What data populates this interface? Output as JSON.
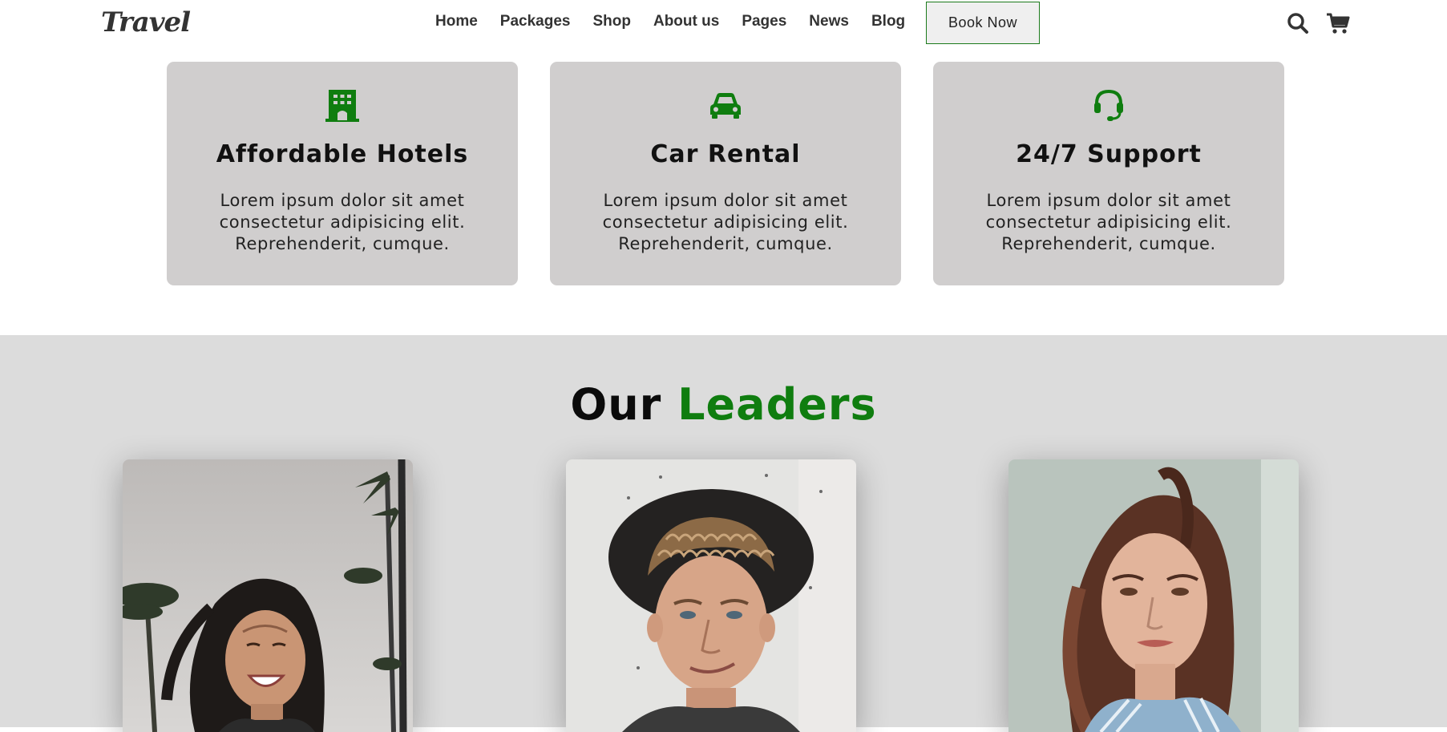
{
  "nav": {
    "logo": "Travel",
    "links": [
      "Home",
      "Packages",
      "Shop",
      "About us",
      "Pages",
      "News",
      "Blog"
    ],
    "book_label": "Book Now",
    "icons": [
      "search-icon",
      "cart-icon"
    ]
  },
  "features": [
    {
      "icon": "building-icon",
      "title": "Affordable Hotels",
      "text": "Lorem ipsum dolor sit amet consectetur adipisicing elit. Reprehenderit, cumque."
    },
    {
      "icon": "car-icon",
      "title": "Car Rental",
      "text": "Lorem ipsum dolor sit amet consectetur adipisicing elit. Reprehenderit, cumque."
    },
    {
      "icon": "headset-icon",
      "title": "24/7 Support",
      "text": "Lorem ipsum dolor sit amet consectetur adipisicing elit. Reprehenderit, cumque."
    }
  ],
  "leaders": {
    "title_part1": "Our",
    "title_part2": "Leaders",
    "photos": [
      "leader-photo-woman-smiling",
      "leader-photo-man-hat",
      "leader-photo-woman-ponytail"
    ]
  },
  "colors": {
    "accent": "#0f7d0f",
    "card_bg": "#d0cece",
    "section_bg": "#dcdcdc",
    "text_dark": "#333333"
  }
}
